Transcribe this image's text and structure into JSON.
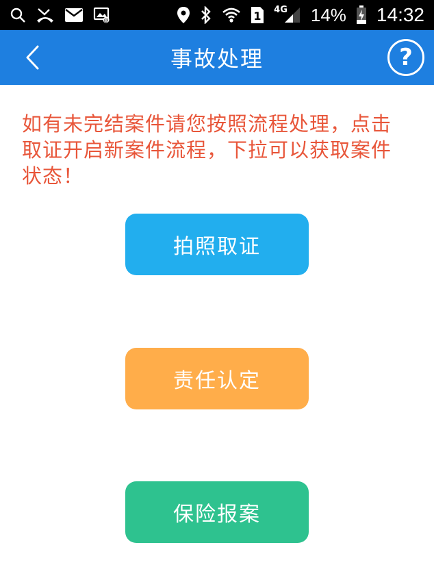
{
  "statusbar": {
    "icons": [
      "search-icon",
      "missed-call-icon",
      "mail-icon",
      "gallery-icon",
      "location-icon",
      "bluetooth-icon",
      "wifi-icon",
      "sim-icon",
      "signal-icon",
      "battery-icon"
    ],
    "sim_slot": "1",
    "network": "4G",
    "battery": "14%",
    "time": "14:32"
  },
  "appbar": {
    "title": "事故处理",
    "help_label": "?"
  },
  "notice": {
    "text": "如有未完结案件请您按照流程处理，点击取证开启新案件流程，下拉可以获取案件状态！"
  },
  "actions": {
    "photo_label": "拍照取证",
    "liability_label": "责任认定",
    "insurance_label": "保险报案"
  },
  "colors": {
    "appbar": "#1e7fe0",
    "notice_text": "#e8563a",
    "photo_button": "#22aeee",
    "liability_button": "#ffad4a",
    "insurance_button": "#2ec28f"
  }
}
